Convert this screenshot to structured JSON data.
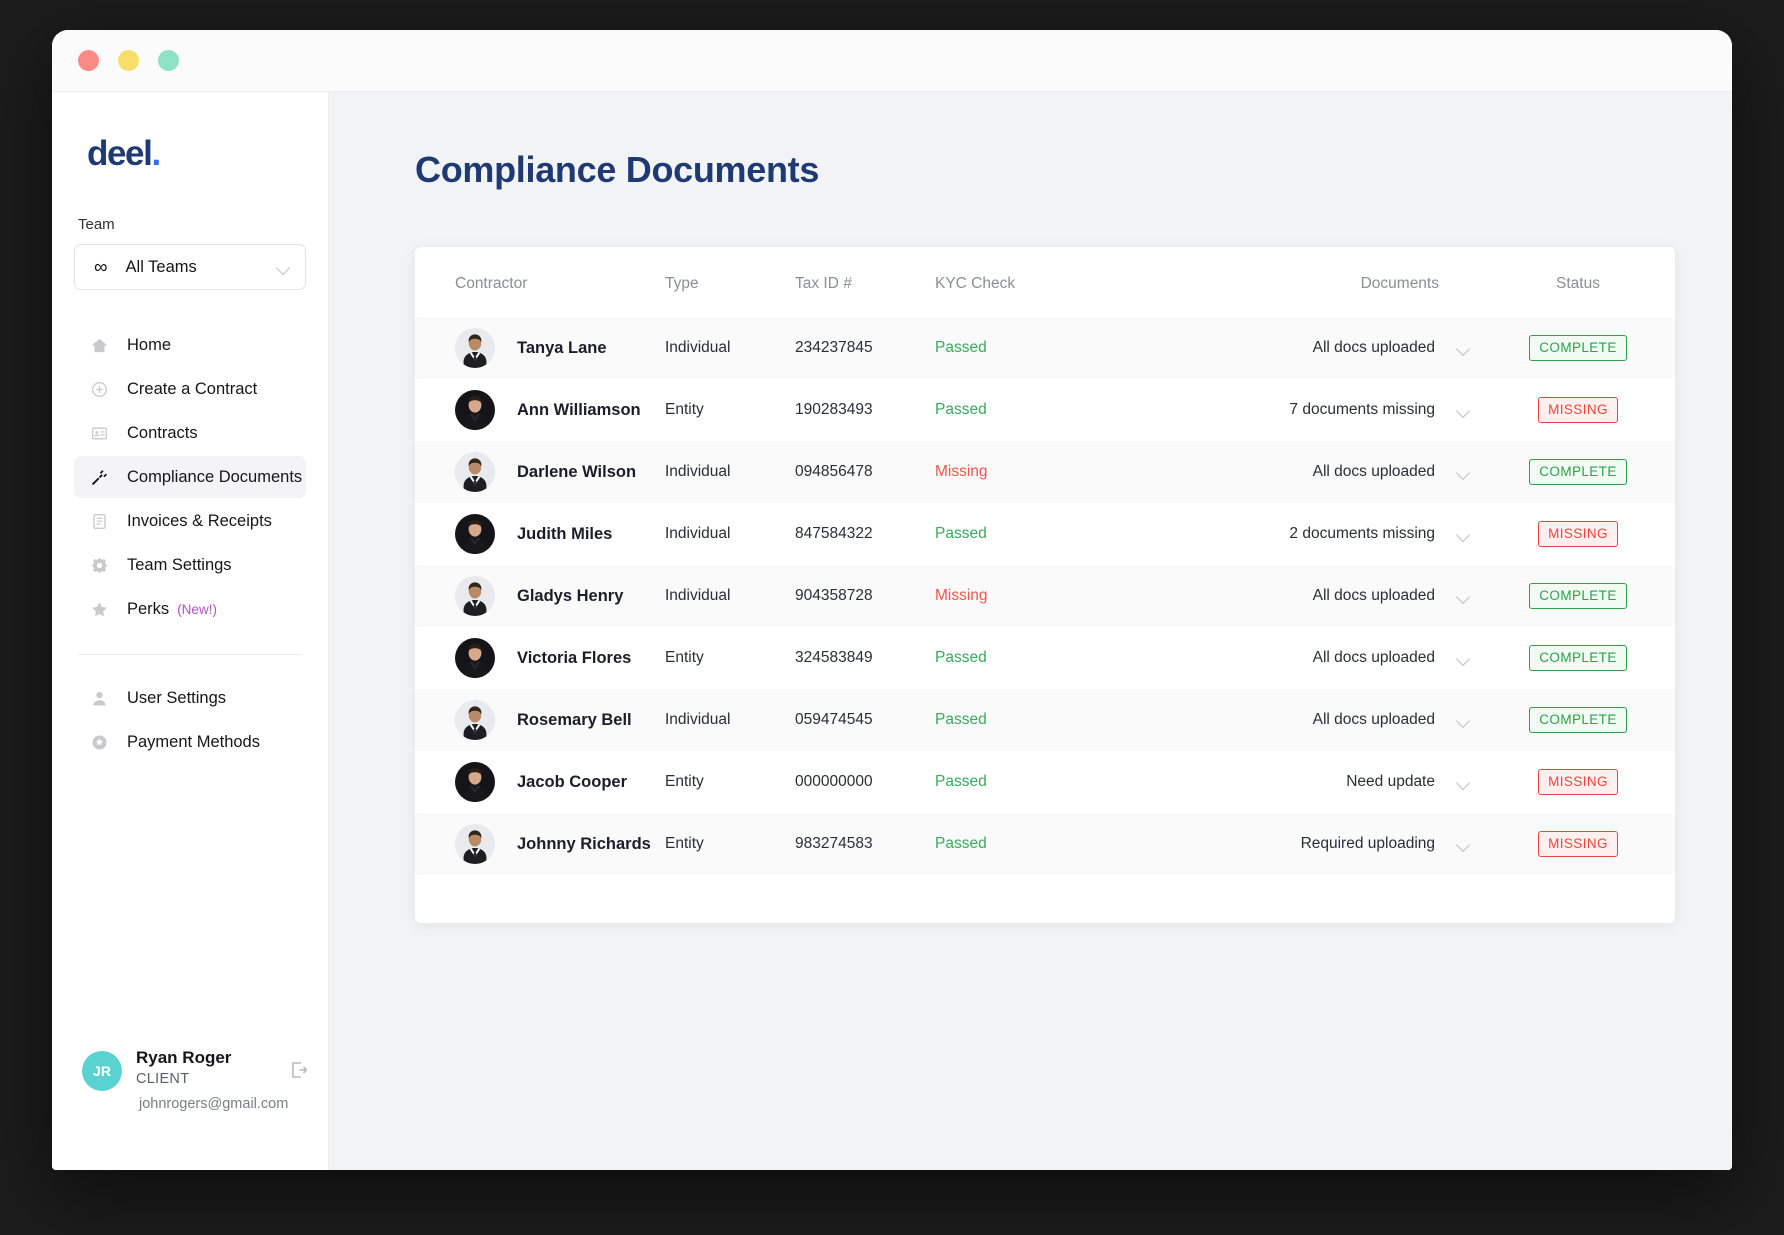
{
  "window": {
    "traffic_lights": [
      "close",
      "minimize",
      "maximize"
    ]
  },
  "sidebar": {
    "logo_text": "deel",
    "logo_dot": ".",
    "team_label": "Team",
    "team_select": {
      "icon": "infinity-icon",
      "value": "All Teams",
      "chevron": "chevron-down-icon"
    },
    "items": [
      {
        "label": "Home",
        "icon": "home-icon",
        "active": false
      },
      {
        "label": "Create a Contract",
        "icon": "plus-circle-icon",
        "active": false
      },
      {
        "label": "Contracts",
        "icon": "document-icon",
        "active": false
      },
      {
        "label": "Compliance Documents",
        "icon": "gavel-icon",
        "active": true
      },
      {
        "label": "Invoices & Receipts",
        "icon": "receipt-icon",
        "active": false
      },
      {
        "label": "Team Settings",
        "icon": "gear-icon",
        "active": false
      },
      {
        "label": "Perks",
        "icon": "star-icon",
        "active": false,
        "tag": "(New!)"
      }
    ],
    "secondary_items": [
      {
        "label": "User Settings",
        "icon": "user-icon"
      },
      {
        "label": "Payment Methods",
        "icon": "payment-icon"
      }
    ],
    "profile": {
      "initials": "JR",
      "name": "Ryan Roger",
      "role": "CLIENT",
      "email": "johnrogers@gmail.com",
      "logout_icon": "logout-icon"
    }
  },
  "main": {
    "page_title": "Compliance Documents",
    "table": {
      "columns": [
        "Contractor",
        "Type",
        "Tax ID #",
        "KYC Check",
        "Documents",
        "Status"
      ],
      "rows": [
        {
          "name": "Tanya Lane",
          "type": "Individual",
          "tax_id": "234237845",
          "kyc": "Passed",
          "kyc_state": "pass",
          "documents": "All docs uploaded",
          "status": "COMPLETE",
          "status_state": "complete",
          "shaded": true,
          "avatar": "man-suit-1"
        },
        {
          "name": "Ann Williamson",
          "type": "Entity",
          "tax_id": "190283493",
          "kyc": "Passed",
          "kyc_state": "pass",
          "documents": "7 documents missing",
          "status": "MISSING",
          "status_state": "missing",
          "shaded": false,
          "avatar": "man-dark-1"
        },
        {
          "name": "Darlene Wilson",
          "type": "Individual",
          "tax_id": "094856478",
          "kyc": "Missing",
          "kyc_state": "missing",
          "documents": "All docs uploaded",
          "status": "COMPLETE",
          "status_state": "complete",
          "shaded": true,
          "avatar": "man-suit-1"
        },
        {
          "name": "Judith Miles",
          "type": "Individual",
          "tax_id": "847584322",
          "kyc": "Passed",
          "kyc_state": "pass",
          "documents": "2 documents missing",
          "status": "MISSING",
          "status_state": "missing",
          "shaded": false,
          "avatar": "man-dark-1"
        },
        {
          "name": "Gladys Henry",
          "type": "Individual",
          "tax_id": "904358728",
          "kyc": "Missing",
          "kyc_state": "missing",
          "documents": "All docs uploaded",
          "status": "COMPLETE",
          "status_state": "complete",
          "shaded": true,
          "avatar": "man-suit-1"
        },
        {
          "name": "Victoria Flores",
          "type": "Entity",
          "tax_id": "324583849",
          "kyc": "Passed",
          "kyc_state": "pass",
          "documents": "All docs uploaded",
          "status": "COMPLETE",
          "status_state": "complete",
          "shaded": false,
          "avatar": "man-dark-1"
        },
        {
          "name": "Rosemary Bell",
          "type": "Individual",
          "tax_id": "059474545",
          "kyc": "Passed",
          "kyc_state": "pass",
          "documents": "All docs uploaded",
          "status": "COMPLETE",
          "status_state": "complete",
          "shaded": true,
          "avatar": "man-suit-1"
        },
        {
          "name": "Jacob Cooper",
          "type": "Entity",
          "tax_id": "000000000",
          "kyc": "Passed",
          "kyc_state": "pass",
          "documents": "Need update",
          "status": "MISSING",
          "status_state": "missing",
          "shaded": false,
          "avatar": "man-dark-1"
        },
        {
          "name": "Johnny Richards",
          "type": "Entity",
          "tax_id": "983274583",
          "kyc": "Passed",
          "kyc_state": "pass",
          "documents": "Required uploading",
          "status": "MISSING",
          "status_state": "missing",
          "shaded": true,
          "avatar": "man-suit-1"
        }
      ]
    }
  },
  "colors": {
    "brand_navy": "#1f3a73",
    "brand_blue": "#2f6fed",
    "pass_green": "#3aa95e",
    "missing_red": "#f2544b",
    "badge_green": "#2aa34a",
    "badge_red": "#f2443c",
    "avatar_teal": "#5ad2d2",
    "new_tag_purple": "#b052c2",
    "page_bg": "#f2f3f5",
    "desktop_bg": "#1c1c1c"
  }
}
